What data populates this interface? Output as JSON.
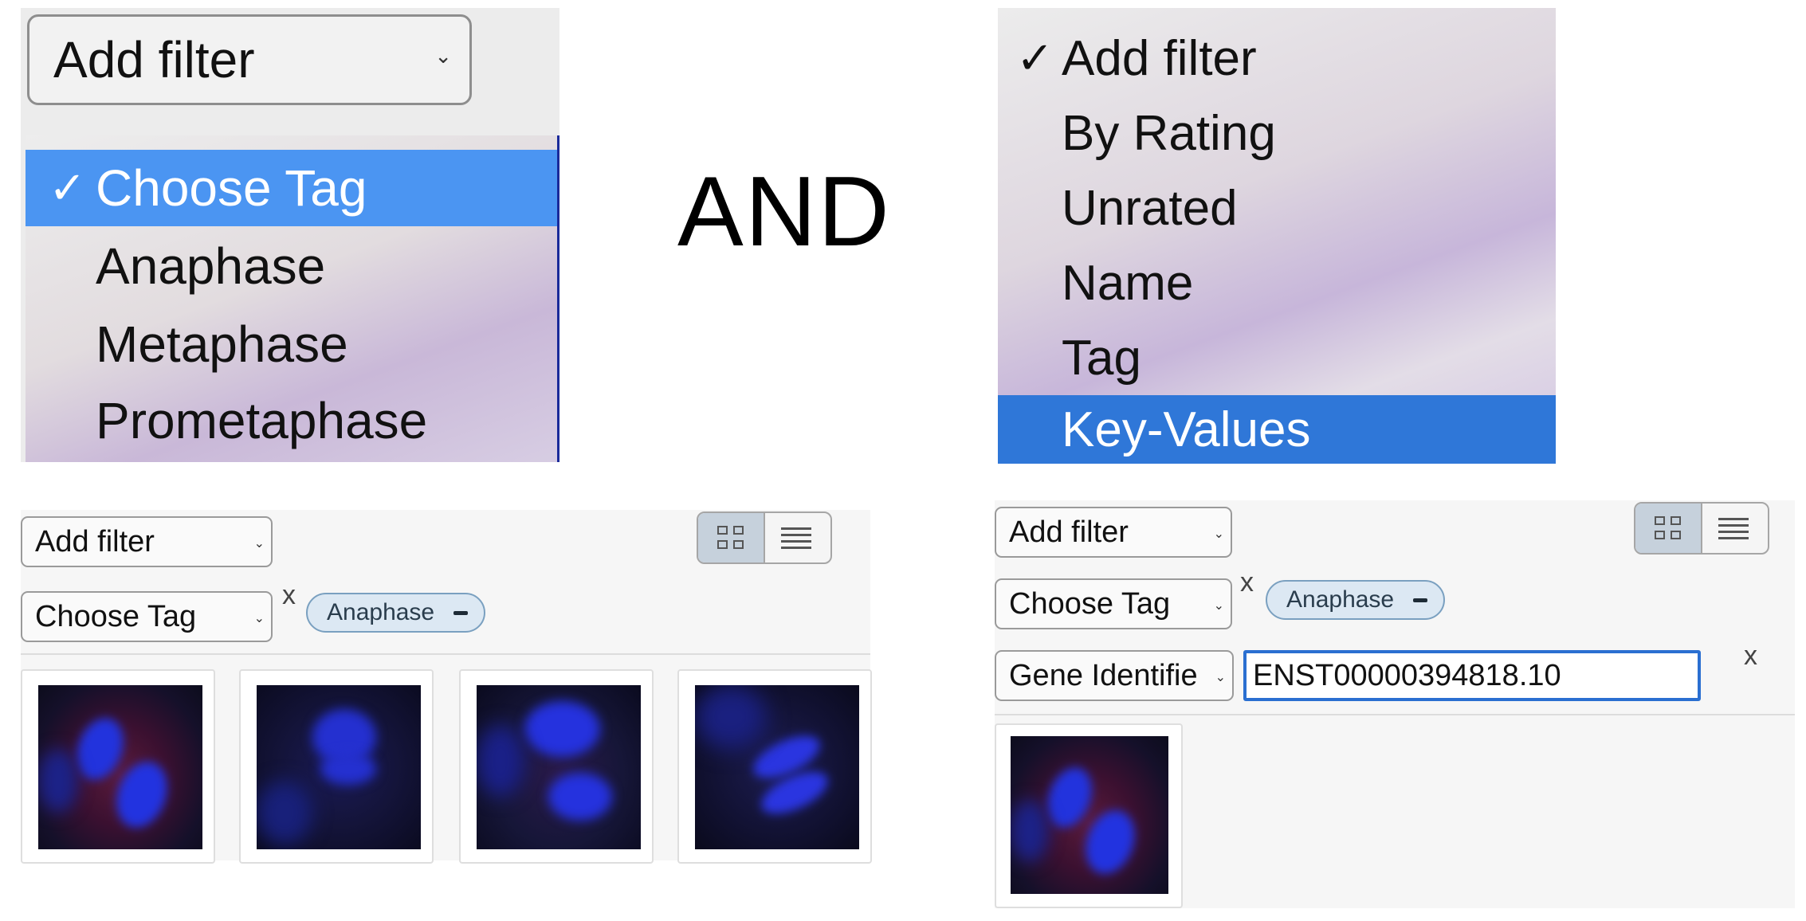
{
  "top_left": {
    "select_label": "Add filter",
    "menu": [
      {
        "label": "Choose Tag",
        "selected": true,
        "check": "✓"
      },
      {
        "label": "Anaphase",
        "selected": false
      },
      {
        "label": "Metaphase",
        "selected": false
      },
      {
        "label": "Prometaphase",
        "selected": false
      }
    ]
  },
  "connector": "AND",
  "top_right": {
    "menu": [
      {
        "label": "Add filter",
        "selected": false,
        "check": "✓"
      },
      {
        "label": "By Rating",
        "selected": false
      },
      {
        "label": "Unrated",
        "selected": false
      },
      {
        "label": "Name",
        "selected": false
      },
      {
        "label": "Tag",
        "selected": false
      },
      {
        "label": "Key-Values",
        "selected": true
      }
    ]
  },
  "bottom_left": {
    "add_filter_label": "Add filter",
    "tag_select_label": "Choose Tag",
    "remove_label": "x",
    "tag_pill": "Anaphase",
    "thumbnail_count": 4
  },
  "bottom_right": {
    "add_filter_label": "Add filter",
    "tag_select_label": "Choose Tag",
    "tag_remove_label": "x",
    "tag_pill": "Anaphase",
    "key_select_label": "Gene Identifie",
    "key_value": "ENST00000394818.10",
    "key_remove_label": "x",
    "thumbnail_count": 1
  },
  "icons": {
    "chevron": "chevron-down-icon",
    "grid": "grid-view-icon",
    "list": "list-view-icon",
    "check": "checkmark-icon",
    "minus": "minus-icon"
  },
  "colors": {
    "menu_highlight_left": "#4b95f2",
    "menu_highlight_right": "#2f77d8",
    "tag_pill_bg": "#dce8f3",
    "input_focus": "#2a6fd1"
  }
}
